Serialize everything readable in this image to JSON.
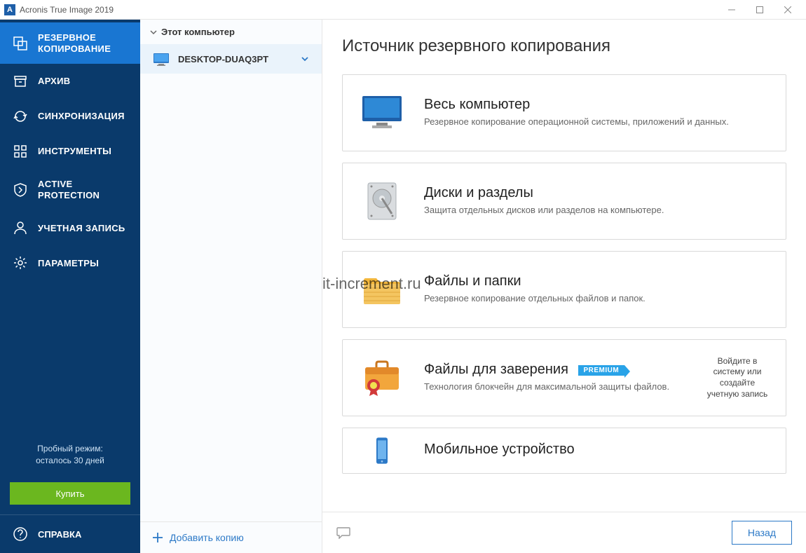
{
  "window": {
    "title": "Acronis True Image 2019",
    "app_letter": "A"
  },
  "sidebar": {
    "items": [
      {
        "label": "РЕЗЕРВНОЕ КОПИРОВАНИЕ"
      },
      {
        "label": "АРХИВ"
      },
      {
        "label": "СИНХРОНИЗАЦИЯ"
      },
      {
        "label": "ИНСТРУМЕНТЫ"
      },
      {
        "label": "ACTIVE PROTECTION"
      },
      {
        "label": "УЧЕТНАЯ ЗАПИСЬ"
      },
      {
        "label": "ПАРАМЕТРЫ"
      }
    ],
    "trial_line1": "Пробный режим:",
    "trial_line2": "осталось 30 дней",
    "buy_label": "Купить",
    "help_label": "СПРАВКА"
  },
  "list_pane": {
    "header": "Этот компьютер",
    "device_name": "DESKTOP-DUAQ3PT",
    "add_copy": "Добавить копию"
  },
  "main": {
    "title": "Источник резервного копирования",
    "cards": [
      {
        "title": "Весь компьютер",
        "desc": "Резервное копирование операционной системы, приложений и данных."
      },
      {
        "title": "Диски и разделы",
        "desc": "Защита отдельных дисков или разделов на компьютере."
      },
      {
        "title": "Файлы и папки",
        "desc": "Резервное копирование отдельных файлов и папок."
      },
      {
        "title": "Файлы для заверения",
        "desc": "Технология блокчейн для максимальной защиты файлов.",
        "premium": "PREMIUM",
        "side": "Войдите в систему или создайте учетную запись"
      },
      {
        "title": "Мобильное устройство",
        "desc": ""
      }
    ],
    "back_label": "Назад",
    "watermark": "it-increment.ru"
  }
}
